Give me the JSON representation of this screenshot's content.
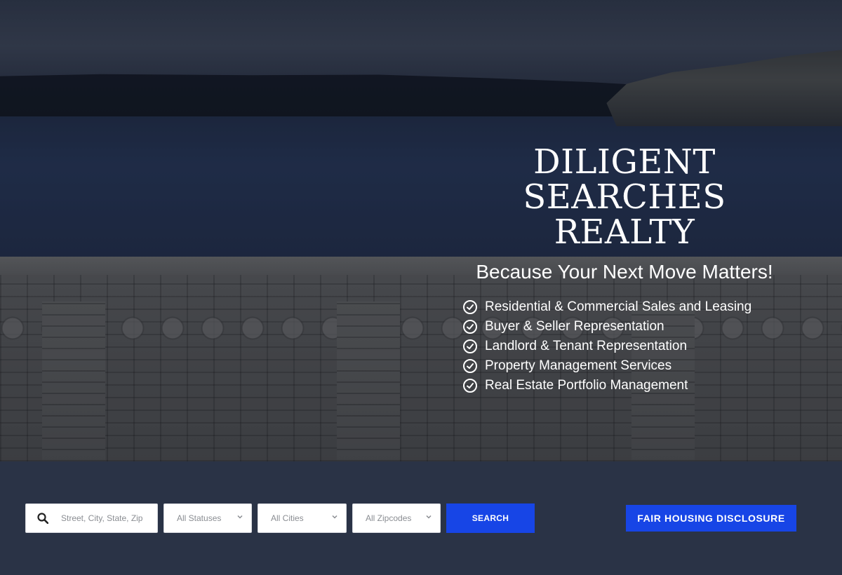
{
  "hero": {
    "title_line1": "DILIGENT SEARCHES",
    "title_line2": "REALTY",
    "tagline": "Because Your Next Move Matters!",
    "features": [
      "Residential & Commercial Sales and Leasing",
      "Buyer & Seller Representation",
      "Landlord & Tenant Representation",
      "Property Management Services",
      "Real Estate Portfolio Management"
    ],
    "feature_icon": "check-circle-icon"
  },
  "search": {
    "placeholder": "Street, City, State, Zip or MLS#",
    "status_selected": "All Statuses",
    "cities_selected": "All Cities",
    "zipcodes_selected": "All Zipcodes",
    "search_button": "SEARCH"
  },
  "fair_housing_button": "FAIR HOUSING DISCLOSURE",
  "colors": {
    "accent": "#1745e6",
    "search_bar_bg": "#2a3346",
    "hero_text": "#ffffff"
  }
}
